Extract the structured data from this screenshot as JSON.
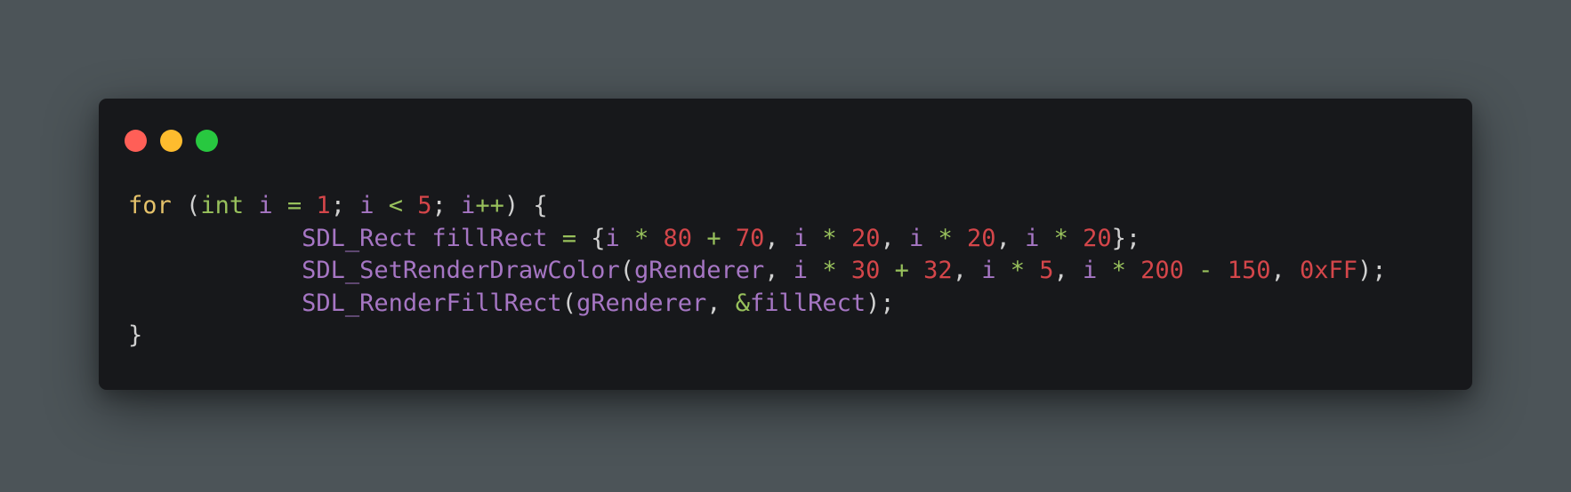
{
  "window": {
    "controls": [
      {
        "name": "close",
        "color": "#ff5f57"
      },
      {
        "name": "minimize",
        "color": "#febc2e"
      },
      {
        "name": "maximize",
        "color": "#28c840"
      }
    ]
  },
  "colors": {
    "background": "#4c5458",
    "editor": "#17181b",
    "keyword": "#e5c26a",
    "type": "#98c15c",
    "identifier": "#a676c4",
    "number": "#d4464a",
    "operator": "#98c15c",
    "punctuation": "#d0d0d0"
  },
  "code": {
    "lines": [
      [
        {
          "t": "for",
          "c": "kw"
        },
        {
          "t": " ",
          "c": "p"
        },
        {
          "t": "(",
          "c": "p"
        },
        {
          "t": "int",
          "c": "type"
        },
        {
          "t": " ",
          "c": "p"
        },
        {
          "t": "i",
          "c": "id"
        },
        {
          "t": " ",
          "c": "p"
        },
        {
          "t": "=",
          "c": "op"
        },
        {
          "t": " ",
          "c": "p"
        },
        {
          "t": "1",
          "c": "num"
        },
        {
          "t": "; ",
          "c": "p"
        },
        {
          "t": "i",
          "c": "id"
        },
        {
          "t": " ",
          "c": "p"
        },
        {
          "t": "<",
          "c": "op"
        },
        {
          "t": " ",
          "c": "p"
        },
        {
          "t": "5",
          "c": "num"
        },
        {
          "t": "; ",
          "c": "p"
        },
        {
          "t": "i",
          "c": "id"
        },
        {
          "t": "++",
          "c": "op"
        },
        {
          "t": ") {",
          "c": "p"
        }
      ],
      [
        {
          "t": "            ",
          "c": "p"
        },
        {
          "t": "SDL_Rect",
          "c": "id"
        },
        {
          "t": " ",
          "c": "p"
        },
        {
          "t": "fillRect",
          "c": "id"
        },
        {
          "t": " ",
          "c": "p"
        },
        {
          "t": "=",
          "c": "op"
        },
        {
          "t": " {",
          "c": "p"
        },
        {
          "t": "i",
          "c": "id"
        },
        {
          "t": " ",
          "c": "p"
        },
        {
          "t": "*",
          "c": "op"
        },
        {
          "t": " ",
          "c": "p"
        },
        {
          "t": "80",
          "c": "num"
        },
        {
          "t": " ",
          "c": "p"
        },
        {
          "t": "+",
          "c": "op"
        },
        {
          "t": " ",
          "c": "p"
        },
        {
          "t": "70",
          "c": "num"
        },
        {
          "t": ", ",
          "c": "p"
        },
        {
          "t": "i",
          "c": "id"
        },
        {
          "t": " ",
          "c": "p"
        },
        {
          "t": "*",
          "c": "op"
        },
        {
          "t": " ",
          "c": "p"
        },
        {
          "t": "20",
          "c": "num"
        },
        {
          "t": ", ",
          "c": "p"
        },
        {
          "t": "i",
          "c": "id"
        },
        {
          "t": " ",
          "c": "p"
        },
        {
          "t": "*",
          "c": "op"
        },
        {
          "t": " ",
          "c": "p"
        },
        {
          "t": "20",
          "c": "num"
        },
        {
          "t": ", ",
          "c": "p"
        },
        {
          "t": "i",
          "c": "id"
        },
        {
          "t": " ",
          "c": "p"
        },
        {
          "t": "*",
          "c": "op"
        },
        {
          "t": " ",
          "c": "p"
        },
        {
          "t": "20",
          "c": "num"
        },
        {
          "t": "};",
          "c": "p"
        }
      ],
      [
        {
          "t": "            ",
          "c": "p"
        },
        {
          "t": "SDL_SetRenderDrawColor",
          "c": "id"
        },
        {
          "t": "(",
          "c": "p"
        },
        {
          "t": "gRenderer",
          "c": "id"
        },
        {
          "t": ", ",
          "c": "p"
        },
        {
          "t": "i",
          "c": "id"
        },
        {
          "t": " ",
          "c": "p"
        },
        {
          "t": "*",
          "c": "op"
        },
        {
          "t": " ",
          "c": "p"
        },
        {
          "t": "30",
          "c": "num"
        },
        {
          "t": " ",
          "c": "p"
        },
        {
          "t": "+",
          "c": "op"
        },
        {
          "t": " ",
          "c": "p"
        },
        {
          "t": "32",
          "c": "num"
        },
        {
          "t": ", ",
          "c": "p"
        },
        {
          "t": "i",
          "c": "id"
        },
        {
          "t": " ",
          "c": "p"
        },
        {
          "t": "*",
          "c": "op"
        },
        {
          "t": " ",
          "c": "p"
        },
        {
          "t": "5",
          "c": "num"
        },
        {
          "t": ", ",
          "c": "p"
        },
        {
          "t": "i",
          "c": "id"
        },
        {
          "t": " ",
          "c": "p"
        },
        {
          "t": "*",
          "c": "op"
        },
        {
          "t": " ",
          "c": "p"
        },
        {
          "t": "200",
          "c": "num"
        },
        {
          "t": " ",
          "c": "p"
        },
        {
          "t": "-",
          "c": "op"
        },
        {
          "t": " ",
          "c": "p"
        },
        {
          "t": "150",
          "c": "num"
        },
        {
          "t": ", ",
          "c": "p"
        },
        {
          "t": "0xFF",
          "c": "num"
        },
        {
          "t": ");",
          "c": "p"
        }
      ],
      [
        {
          "t": "            ",
          "c": "p"
        },
        {
          "t": "SDL_RenderFillRect",
          "c": "id"
        },
        {
          "t": "(",
          "c": "p"
        },
        {
          "t": "gRenderer",
          "c": "id"
        },
        {
          "t": ", ",
          "c": "p"
        },
        {
          "t": "&",
          "c": "op"
        },
        {
          "t": "fillRect",
          "c": "id"
        },
        {
          "t": ");",
          "c": "p"
        }
      ],
      [
        {
          "t": "}",
          "c": "p"
        }
      ]
    ]
  }
}
